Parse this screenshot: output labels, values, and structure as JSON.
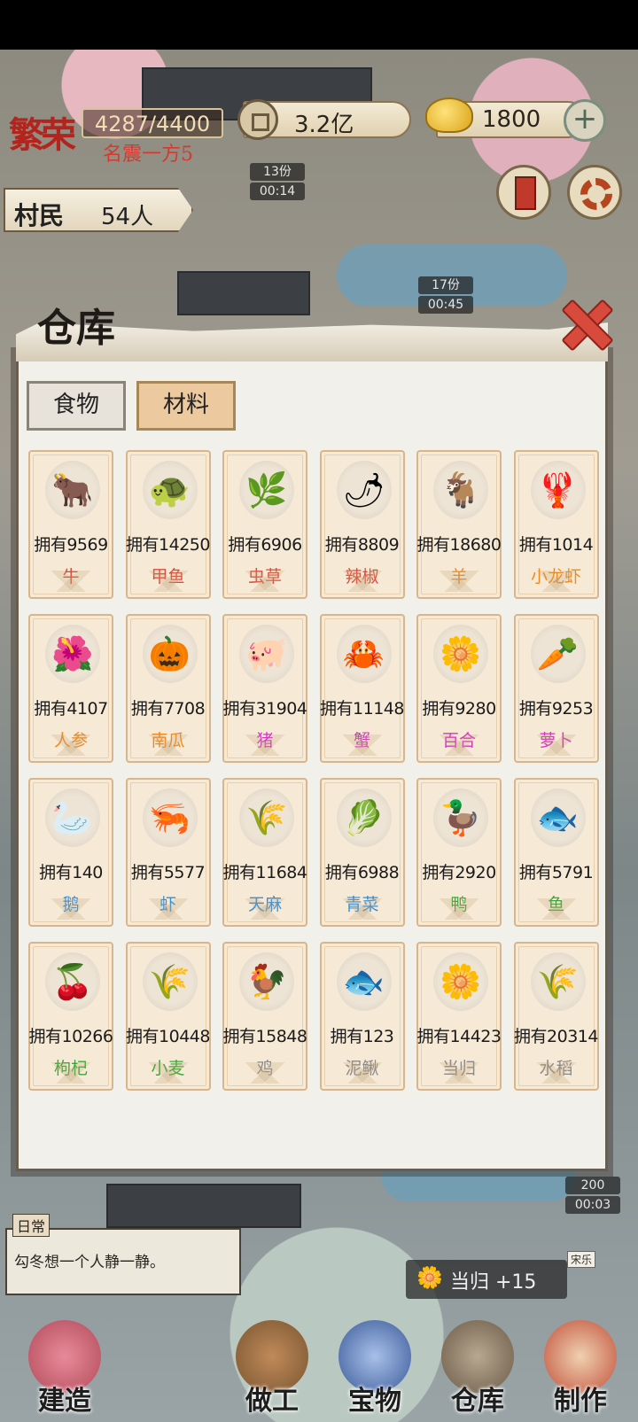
{
  "hud": {
    "fame_value": "4287/4400",
    "fame_title": "名震一方5",
    "fame_logo": "繁荣",
    "coins": "3.2亿",
    "gold": "1800",
    "plus": "+",
    "villager_label": "村民",
    "villager_count": "54人",
    "timers": [
      "13份",
      "00:14",
      "17份",
      "00:45",
      "200",
      "00:03"
    ]
  },
  "panel": {
    "title": "仓库",
    "tabs": [
      {
        "label": "食物",
        "active": false
      },
      {
        "label": "材料",
        "active": true
      }
    ]
  },
  "items": [
    {
      "count": "拥有9569",
      "name": "牛",
      "icon": "ox-icon",
      "glyph": "🐂",
      "color": "#e04a3a"
    },
    {
      "count": "拥有14250",
      "name": "甲鱼",
      "icon": "turtle-icon",
      "glyph": "🐢",
      "color": "#e04a3a"
    },
    {
      "count": "拥有6906",
      "name": "虫草",
      "icon": "cordyceps-icon",
      "glyph": "🌿",
      "color": "#e04a3a"
    },
    {
      "count": "拥有8809",
      "name": "辣椒",
      "icon": "chili-icon",
      "glyph": "🌶",
      "color": "#e04a3a"
    },
    {
      "count": "拥有18680",
      "name": "羊",
      "icon": "goat-icon",
      "glyph": "🐐",
      "color": "#f08a1e"
    },
    {
      "count": "拥有1014",
      "name": "小龙虾",
      "icon": "crayfish-icon",
      "glyph": "🦞",
      "color": "#f08a1e"
    },
    {
      "count": "拥有4107",
      "name": "人参",
      "icon": "ginseng-icon",
      "glyph": "🌺",
      "color": "#f08a1e"
    },
    {
      "count": "拥有7708",
      "name": "南瓜",
      "icon": "pumpkin-icon",
      "glyph": "🎃",
      "color": "#f08a1e"
    },
    {
      "count": "拥有31904",
      "name": "猪",
      "icon": "pig-icon",
      "glyph": "🐖",
      "color": "#d633c7"
    },
    {
      "count": "拥有11148",
      "name": "蟹",
      "icon": "crab-icon",
      "glyph": "🦀",
      "color": "#d633c7"
    },
    {
      "count": "拥有9280",
      "name": "百合",
      "icon": "lily-icon",
      "glyph": "🌼",
      "color": "#d633c7"
    },
    {
      "count": "拥有9253",
      "name": "萝卜",
      "icon": "radish-icon",
      "glyph": "🥕",
      "color": "#d633c7"
    },
    {
      "count": "拥有140",
      "name": "鹅",
      "icon": "goose-icon",
      "glyph": "🦢",
      "color": "#2f8fe0"
    },
    {
      "count": "拥有5577",
      "name": "虾",
      "icon": "shrimp-icon",
      "glyph": "🦐",
      "color": "#2f8fe0"
    },
    {
      "count": "拥有11684",
      "name": "天麻",
      "icon": "gastrodia-icon",
      "glyph": "🌾",
      "color": "#2f8fe0"
    },
    {
      "count": "拥有6988",
      "name": "青菜",
      "icon": "greens-icon",
      "glyph": "🥬",
      "color": "#2f8fe0"
    },
    {
      "count": "拥有2920",
      "name": "鸭",
      "icon": "duck-icon",
      "glyph": "🦆",
      "color": "#3aa838"
    },
    {
      "count": "拥有5791",
      "name": "鱼",
      "icon": "fish-icon",
      "glyph": "🐟",
      "color": "#3aa838"
    },
    {
      "count": "拥有10266",
      "name": "枸杞",
      "icon": "goji-icon",
      "glyph": "🍒",
      "color": "#3aa838"
    },
    {
      "count": "拥有10448",
      "name": "小麦",
      "icon": "wheat-icon",
      "glyph": "🌾",
      "color": "#3aa838"
    },
    {
      "count": "拥有15848",
      "name": "鸡",
      "icon": "rooster-icon",
      "glyph": "🐓",
      "color": "#8a8a8a"
    },
    {
      "count": "拥有123",
      "name": "泥鳅",
      "icon": "loach-icon",
      "glyph": "🐟",
      "color": "#8a8a8a"
    },
    {
      "count": "拥有14423",
      "name": "当归",
      "icon": "angelica-icon",
      "glyph": "🌼",
      "color": "#8a8a8a"
    },
    {
      "count": "拥有20314",
      "name": "水稻",
      "icon": "rice-icon",
      "glyph": "🌾",
      "color": "#8a8a8a"
    }
  ],
  "daily": {
    "tag": "日常",
    "text": "勾冬想一个人静一静。"
  },
  "toast": {
    "text": "当归 +15"
  },
  "npc": {
    "name": "宋乐"
  },
  "nav": [
    {
      "label": "建造",
      "icon": "build-icon"
    },
    {
      "label": "做工",
      "icon": "work-icon"
    },
    {
      "label": "宝物",
      "icon": "treasure-icon"
    },
    {
      "label": "仓库",
      "icon": "warehouse-icon"
    },
    {
      "label": "制作",
      "icon": "craft-icon"
    }
  ]
}
